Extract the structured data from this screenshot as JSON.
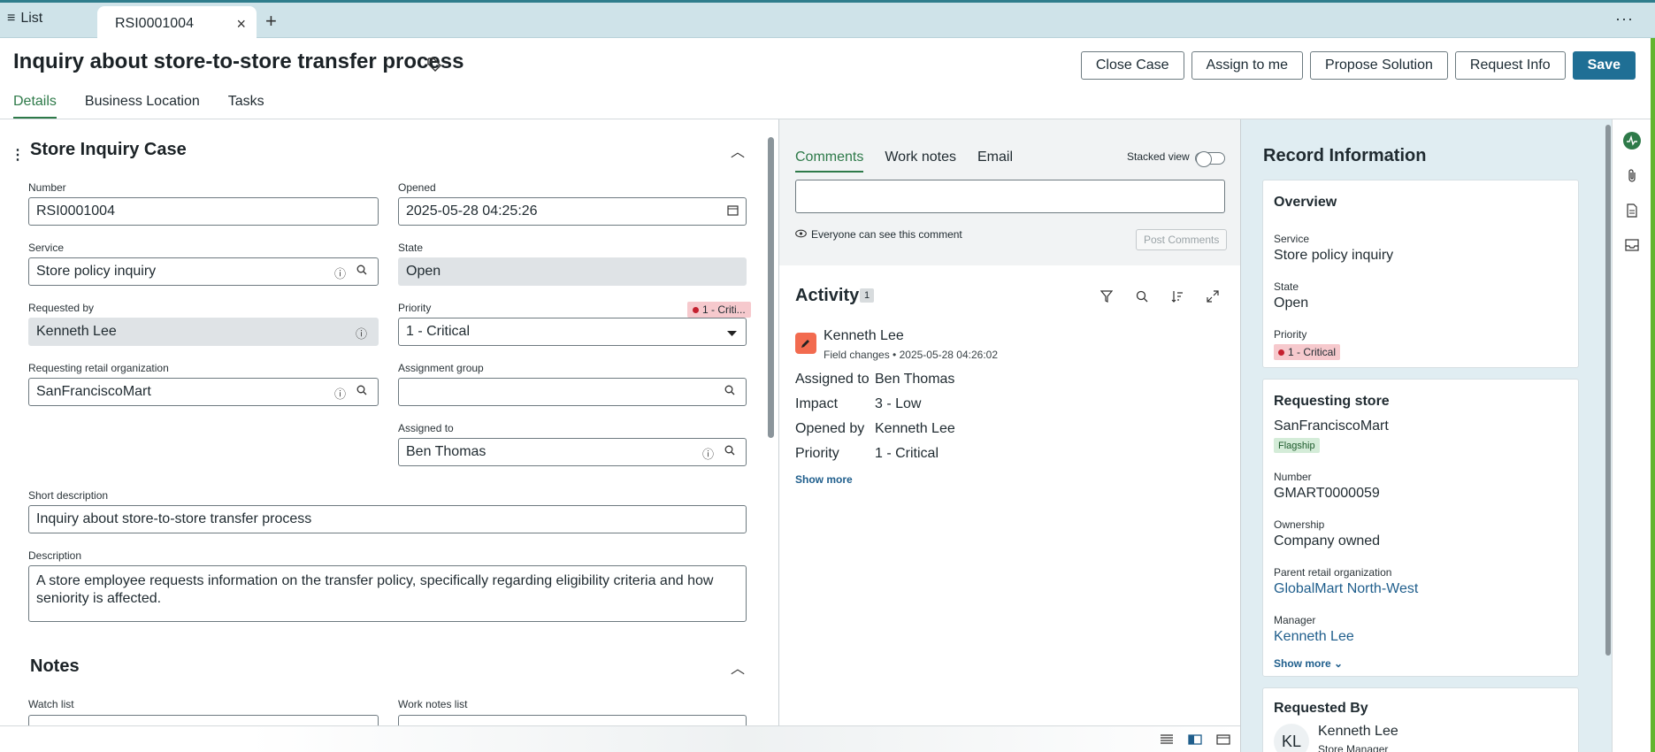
{
  "topbar": {
    "list_label": "List",
    "list_icon": "≡",
    "active_tab": "RSI0001004",
    "close_glyph": "×",
    "add_glyph": "+",
    "more_glyph": "···"
  },
  "header": {
    "title": "Inquiry about store-to-store transfer process",
    "buttons": {
      "close_case": "Close Case",
      "assign_to_me": "Assign to me",
      "propose_solution": "Propose Solution",
      "request_info": "Request Info",
      "save": "Save"
    },
    "tabs": [
      "Details",
      "Business Location",
      "Tasks"
    ]
  },
  "form": {
    "section_title": "Store Inquiry Case",
    "number": {
      "label": "Number",
      "value": "RSI0001004"
    },
    "opened": {
      "label": "Opened",
      "value": "2025-05-28 04:25:26"
    },
    "service": {
      "label": "Service",
      "value": "Store policy inquiry"
    },
    "state": {
      "label": "State",
      "value": "Open"
    },
    "requested_by": {
      "label": "Requested by",
      "value": "Kenneth Lee"
    },
    "priority": {
      "label": "Priority",
      "value": "1 - Critical",
      "badge": "1 - Criti..."
    },
    "retail_org": {
      "label": "Requesting retail organization",
      "value": "SanFranciscoMart"
    },
    "assignment_group": {
      "label": "Assignment group",
      "value": ""
    },
    "assigned_to": {
      "label": "Assigned to",
      "value": "Ben Thomas"
    },
    "short_description": {
      "label": "Short description",
      "value": "Inquiry about store-to-store transfer process"
    },
    "description": {
      "label": "Description",
      "value": "A store employee requests information on the transfer policy, specifically regarding eligibility criteria and how seniority is affected."
    },
    "notes_title": "Notes",
    "watch_list_label": "Watch list",
    "work_notes_list_label": "Work notes list"
  },
  "activity_panel": {
    "tabs": [
      "Comments",
      "Work notes",
      "Email"
    ],
    "stacked_view": "Stacked view",
    "visibility": "Everyone can see this comment",
    "post_button": "Post Comments",
    "activity_title": "Activity",
    "activity_count": "1",
    "entry": {
      "author": "Kenneth Lee",
      "type": "Field changes",
      "timestamp": "2025-05-28 04:26:02",
      "rows": [
        {
          "key": "Assigned to",
          "value": "Ben Thomas"
        },
        {
          "key": "Impact",
          "value": "3 - Low"
        },
        {
          "key": "Opened by",
          "value": "Kenneth Lee"
        },
        {
          "key": "Priority",
          "value": "1 - Critical"
        }
      ]
    },
    "show_more": "Show more"
  },
  "record_info": {
    "title": "Record Information",
    "overview": {
      "heading": "Overview",
      "service_label": "Service",
      "service": "Store policy inquiry",
      "state_label": "State",
      "state": "Open",
      "priority_label": "Priority",
      "priority": "1 - Critical"
    },
    "store": {
      "heading": "Requesting store",
      "name": "SanFranciscoMart",
      "badge": "Flagship",
      "number_label": "Number",
      "number": "GMART0000059",
      "ownership_label": "Ownership",
      "ownership": "Company owned",
      "parent_label": "Parent retail organization",
      "parent": "GlobalMart North-West",
      "manager_label": "Manager",
      "manager": "Kenneth Lee",
      "show_more": "Show more"
    },
    "requested_by": {
      "heading": "Requested By",
      "initials": "KL",
      "name": "Kenneth Lee",
      "role": "Store Manager"
    }
  },
  "colors": {
    "accent_green": "#2e7a49",
    "primary_blue": "#1f6f95",
    "critical_red": "#c4202f"
  }
}
